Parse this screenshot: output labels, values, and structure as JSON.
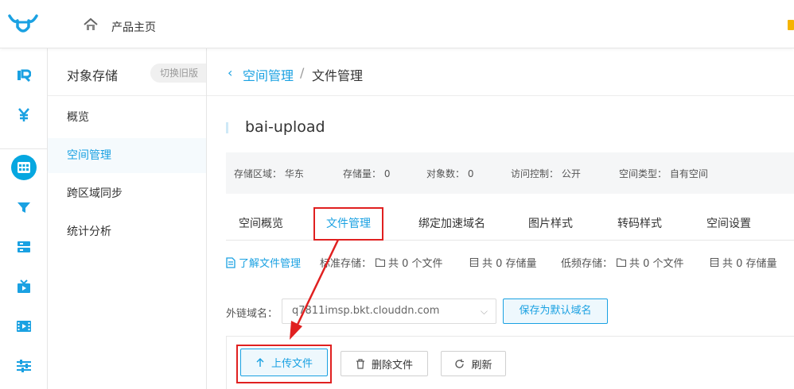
{
  "topbar": {
    "home_label": "产品主页",
    "icons": [
      "logo-icon",
      "home-icon"
    ]
  },
  "rail": {
    "items": [
      {
        "name": "rail-brand-icon"
      },
      {
        "name": "rail-yen-icon"
      },
      {
        "name": "rail-storage-icon",
        "active": true
      },
      {
        "name": "rail-filter-icon"
      },
      {
        "name": "rail-server-icon"
      },
      {
        "name": "rail-tv-icon"
      },
      {
        "name": "rail-film-icon"
      },
      {
        "name": "rail-sliders-icon"
      }
    ]
  },
  "sidenav": {
    "title": "对象存储",
    "legacy_button": "切换旧版",
    "items": [
      {
        "label": "概览"
      },
      {
        "label": "空间管理",
        "active": true
      },
      {
        "label": "跨区域同步"
      },
      {
        "label": "统计分析"
      }
    ]
  },
  "breadcrumb": {
    "parent": "空间管理",
    "separator": "/",
    "current": "文件管理"
  },
  "bucket": {
    "name": "bai-upload",
    "info": [
      {
        "label": "存储区域：",
        "value": "华东"
      },
      {
        "label": "存储量：",
        "value": "0"
      },
      {
        "label": "对象数：",
        "value": "0"
      },
      {
        "label": "访问控制：",
        "value": "公开"
      },
      {
        "label": "空间类型：",
        "value": "自有空间"
      }
    ]
  },
  "tabs": [
    {
      "label": "空间概览"
    },
    {
      "label": "文件管理",
      "active": true
    },
    {
      "label": "绑定加速域名"
    },
    {
      "label": "图片样式"
    },
    {
      "label": "转码样式"
    },
    {
      "label": "空间设置"
    }
  ],
  "stats": {
    "learn_link": "了解文件管理",
    "standard_label": "标准存储：",
    "standard_files": "共 0 个文件",
    "standard_size": "共 0 存储量",
    "low_label": "低频存储：",
    "low_files": "共 0 个文件",
    "low_size": "共 0 存储量"
  },
  "domain": {
    "label": "外链域名：",
    "value": "q7811imsp.bkt.clouddn.com",
    "save_button": "保存为默认域名"
  },
  "actions": {
    "upload": "上传文件",
    "delete": "删除文件",
    "refresh": "刷新"
  },
  "colors": {
    "accent": "#1aa1e2",
    "annotation": "#e02020",
    "active_rail": "#06a7e0"
  }
}
